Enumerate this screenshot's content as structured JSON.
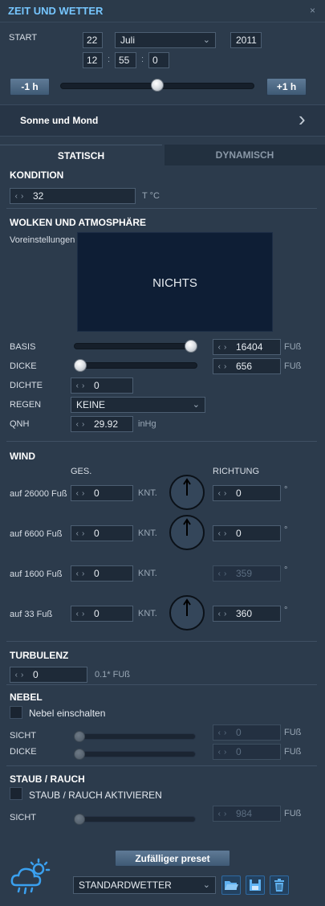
{
  "window": {
    "title": "ZEIT UND WETTER",
    "close_symbol": "×"
  },
  "start": {
    "label": "START",
    "day": "22",
    "month": "Juli",
    "year": "2011",
    "hour": "12",
    "minute": "55",
    "second": "0",
    "time_sep": ":",
    "minus_hour": "-1 h",
    "plus_hour": "+1 h",
    "time_slider_value": 0.5
  },
  "sun_moon": {
    "label": "Sonne und Mond",
    "chevron": "›"
  },
  "tabs": [
    {
      "label": "STATISCH"
    },
    {
      "label": "DYNAMISCH"
    }
  ],
  "condition": {
    "title": "KONDITION",
    "temperature": "32",
    "unit": "T °C"
  },
  "clouds": {
    "title": "WOLKEN UND ATMOSPHÄRE",
    "presets_label": "Voreinstellungen",
    "preset_name": "NICHTS",
    "base_label": "BASIS",
    "base_value": "16404",
    "base_unit": "FUß",
    "base_slider": 1.0,
    "thickness_label": "DICKE",
    "thickness_value": "656",
    "thickness_unit": "FUß",
    "thickness_slider": 0.0,
    "density_label": "DICHTE",
    "density_value": "0",
    "rain_label": "REGEN",
    "rain_value": "KEINE",
    "qnh_label": "QNH",
    "qnh_value": "29.92",
    "qnh_unit": "inHg"
  },
  "wind": {
    "title": "WIND",
    "speed_header": "GES.",
    "dir_header": "RICHTUNG",
    "speed_unit": "KNT.",
    "dir_unit": "°",
    "rows": [
      {
        "label": "auf 26000 Fuß",
        "speed": "0",
        "direction": "0",
        "has_dial": true,
        "disabled": false
      },
      {
        "label": "auf 6600 Fuß",
        "speed": "0",
        "direction": "0",
        "has_dial": true,
        "disabled": false
      },
      {
        "label": "auf 1600 Fuß",
        "speed": "0",
        "direction": "359",
        "has_dial": false,
        "disabled": true
      },
      {
        "label": "auf 33 Fuß",
        "speed": "0",
        "direction": "360",
        "has_dial": true,
        "disabled": false
      }
    ]
  },
  "turbulence": {
    "title": "TURBULENZ",
    "value": "0",
    "unit": "0.1* FUß"
  },
  "fog": {
    "title": "NEBEL",
    "enable_label": "Nebel einschalten",
    "visibility_label": "SICHT",
    "visibility_value": "0",
    "visibility_unit": "FUß",
    "thickness_label": "DICKE",
    "thickness_value": "0",
    "thickness_unit": "FUß"
  },
  "dust": {
    "title": "STAUB / RAUCH",
    "enable_label": "STAUB / RAUCH AKTIVIEREN",
    "visibility_label": "SICHT",
    "visibility_value": "984",
    "visibility_unit": "FUß"
  },
  "footer": {
    "random_preset": "Zufälliger preset",
    "preset_value": "STANDARDWETTER",
    "icons": [
      "weather-icon",
      "folder-open-icon",
      "save-icon",
      "trash-icon"
    ]
  },
  "colors": {
    "accent": "#76c6ff",
    "panel": "#2c3b4c",
    "field": "#1e2a38"
  }
}
